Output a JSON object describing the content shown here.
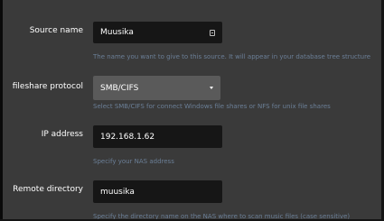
{
  "form": {
    "source_name": {
      "label": "Source name",
      "value": "Muusika",
      "hint": "The name you want to give to this source. It will appear in your database tree structure",
      "icon": "text-field-icon"
    },
    "fileshare_protocol": {
      "label": "fileshare protocol",
      "value": "SMB/CIFS",
      "hint": "Select SMB/CIFS for connect Windows file shares or NFS for unix file shares",
      "icon": "chevron-down-icon"
    },
    "ip_address": {
      "label": "IP address",
      "value": "192.168.1.62",
      "hint": "Specify your NAS address"
    },
    "remote_directory": {
      "label": "Remote directory",
      "value": "muusika",
      "hint": "Specify the directory name on the NAS where to scan music files (case sensitive)"
    }
  },
  "colors": {
    "panel_background": "#3a3a3a",
    "input_background": "#161616",
    "select_background": "#5a5a5a",
    "hint_text": "#6b7f97",
    "label_text": "#ffffff"
  }
}
